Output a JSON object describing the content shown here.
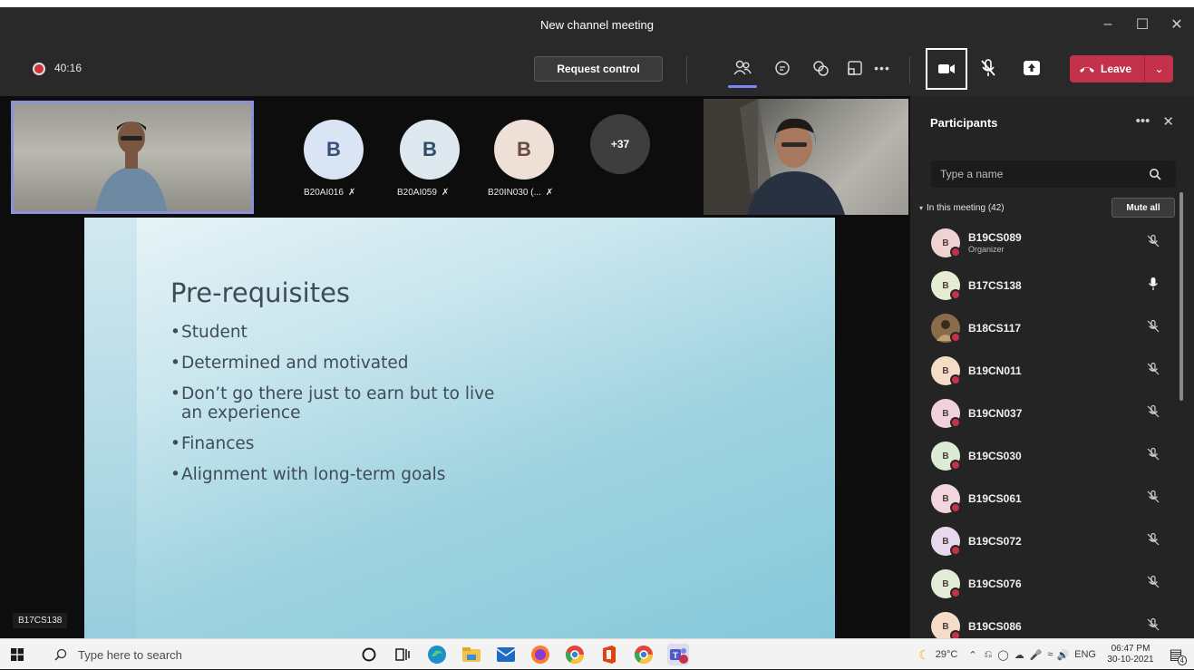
{
  "window": {
    "title": "New channel meeting",
    "controls": [
      "–",
      "☐",
      "✕"
    ]
  },
  "toolbar": {
    "recording_time": "40:16",
    "request_control_label": "Request control",
    "leave_label": "Leave",
    "more_label": "•••"
  },
  "stage": {
    "tiles": [
      {
        "initial": "B",
        "name": "B20AI016",
        "color": "#d9e4f5",
        "text_color": "#3b4f7a"
      },
      {
        "initial": "B",
        "name": "B20AI059",
        "color": "#dde9ef",
        "text_color": "#2f4e66"
      },
      {
        "initial": "B",
        "name": "B20IN030 (...",
        "color": "#efe0d7",
        "text_color": "#6b4a3f"
      }
    ],
    "more_count": "+37",
    "active_speaker": "B17CS138"
  },
  "slide": {
    "title": "Pre-requisites",
    "bullets": [
      "Student",
      "Determined and motivated",
      "Don’t go there just to earn but to live an experience",
      "Finances",
      "Alignment with long-term goals"
    ]
  },
  "participants": {
    "heading": "Participants",
    "more": "•••",
    "close": "✕",
    "search_placeholder": "Type a name",
    "section_label": "In this meeting (42)",
    "mute_all_label": "Mute all",
    "list": [
      {
        "name": "B19CS089",
        "role": "Organizer",
        "initial": "B",
        "color": "#efd3d3",
        "mic": "muted"
      },
      {
        "name": "B17CS138",
        "role": "",
        "initial": "B",
        "color": "#e4ecd3",
        "mic": "on"
      },
      {
        "name": "B18CS117",
        "role": "",
        "initial": "",
        "color": "#7a5a3a",
        "mic": "muted"
      },
      {
        "name": "B19CN011",
        "role": "",
        "initial": "B",
        "color": "#f5dcc6",
        "mic": "muted"
      },
      {
        "name": "B19CN037",
        "role": "",
        "initial": "B",
        "color": "#f1d2dc",
        "mic": "muted"
      },
      {
        "name": "B19CS030",
        "role": "",
        "initial": "B",
        "color": "#dcebd6",
        "mic": "muted"
      },
      {
        "name": "B19CS061",
        "role": "",
        "initial": "B",
        "color": "#f2d6de",
        "mic": "muted"
      },
      {
        "name": "B19CS072",
        "role": "",
        "initial": "B",
        "color": "#e8d8ee",
        "mic": "muted"
      },
      {
        "name": "B19CS076",
        "role": "",
        "initial": "B",
        "color": "#e3ecd7",
        "mic": "muted"
      },
      {
        "name": "B19CS086",
        "role": "",
        "initial": "B",
        "color": "#f5dcc6",
        "mic": "muted"
      }
    ]
  },
  "taskbar": {
    "search_placeholder": "Type here to search",
    "weather": "29°C",
    "language": "ENG",
    "time": "06:47 PM",
    "date": "30-10-2021",
    "notifications": "4"
  }
}
